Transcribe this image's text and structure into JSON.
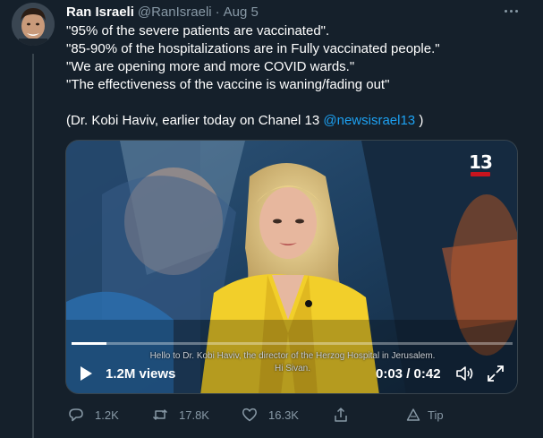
{
  "tweet": {
    "author_name": "Ran Israeli",
    "handle": "@RanIsraeli",
    "separator": "·",
    "date": "Aug 5",
    "lines": [
      "\"95% of the severe patients are vaccinated\".",
      "\"85-90% of the hospitalizations are in Fully vaccinated people.\"",
      "\"We are opening more and more COVID wards.\"",
      "\"The effectiveness of the vaccine is waning/fading out\""
    ],
    "attribution_prefix": "(Dr. Kobi Haviv, earlier today on Chanel 13 ",
    "mention": "@newsisrael13",
    "attribution_suffix": " )"
  },
  "media": {
    "channel_logo": "13",
    "subtitle_line1": "Hello to Dr. Kobi Haviv, the director of the Herzog Hospital in Jerusalem.",
    "subtitle_line2": "Hi Sivan.",
    "views": "1.2M views",
    "time": "0:03 / 0:42",
    "progress": 0.08
  },
  "actions": {
    "replies": "1.2K",
    "retweets": "17.8K",
    "likes": "16.3K",
    "tip_label": "Tip"
  },
  "colors": {
    "background": "#15202b",
    "secondary_text": "#8899a6",
    "link": "#1da1f2",
    "jacket": "#f2cf2a"
  },
  "icons": [
    "more-icon",
    "play-icon",
    "volume-icon",
    "fullscreen-icon",
    "reply-icon",
    "retweet-icon",
    "like-icon",
    "share-icon",
    "tip-icon"
  ]
}
